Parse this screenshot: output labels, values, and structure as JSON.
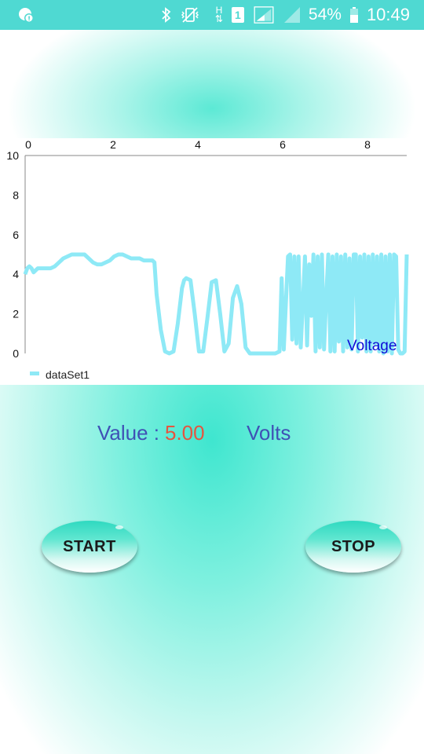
{
  "status_bar": {
    "battery_percent": "54%",
    "time": "10:49",
    "network_label_h": "H",
    "sim_slot": "1",
    "icons": [
      "notification-icon",
      "bluetooth-icon",
      "vibrate-icon",
      "network-h-icon",
      "sim-1-icon",
      "signal-icon",
      "signal-empty-icon",
      "battery-icon"
    ]
  },
  "chart_data": {
    "type": "line",
    "x_ticks": [
      "0",
      "2",
      "4",
      "6",
      "8"
    ],
    "y_ticks": [
      "10",
      "8",
      "6",
      "4",
      "2",
      "0"
    ],
    "xlim": [
      0,
      9
    ],
    "ylim": [
      0,
      10
    ],
    "annotation": "Voltage",
    "legend": {
      "position": "bottom-left"
    },
    "grid": false,
    "series": [
      {
        "name": "dataSet1",
        "color": "#8ee9f6",
        "x": [
          0,
          0.05,
          0.1,
          0.15,
          0.2,
          0.3,
          0.4,
          0.45,
          0.5,
          0.6,
          0.7,
          0.8,
          0.9,
          1.0,
          1.1,
          1.2,
          1.3,
          1.4,
          1.5,
          1.6,
          1.7,
          1.8,
          1.9,
          2.0,
          2.1,
          2.2,
          2.3,
          2.4,
          2.5,
          2.6,
          2.7,
          2.8,
          2.9,
          3.0,
          3.05,
          3.1,
          3.2,
          3.3,
          3.4,
          3.5,
          3.6,
          3.7,
          3.75,
          3.8,
          3.9,
          4.0,
          4.1,
          4.2,
          4.3,
          4.4,
          4.5,
          4.6,
          4.7,
          4.8,
          4.9,
          5.0,
          5.1,
          5.2,
          5.3,
          5.4,
          5.5,
          5.6,
          5.7,
          5.8,
          5.9,
          6.0,
          6.05,
          6.1,
          6.2,
          6.25,
          6.3,
          6.35,
          6.4,
          6.45,
          6.5,
          6.55,
          6.6,
          6.65,
          6.7,
          6.75,
          6.8,
          6.85,
          6.9,
          6.95,
          7.0,
          7.05,
          7.1,
          7.15,
          7.2,
          7.25,
          7.3,
          7.35,
          7.4,
          7.45,
          7.5,
          7.55,
          7.6,
          7.65,
          7.7,
          7.75,
          7.8,
          7.85,
          7.9,
          7.95,
          8.0,
          8.05,
          8.1,
          8.15,
          8.2,
          8.25,
          8.3,
          8.35,
          8.4,
          8.45,
          8.5,
          8.55,
          8.6,
          8.65,
          8.7,
          8.75,
          8.8,
          8.85,
          8.9,
          8.95,
          9.0
        ],
        "values": [
          4.0,
          4.3,
          4.4,
          4.3,
          4.1,
          4.3,
          4.3,
          4.3,
          4.3,
          4.3,
          4.4,
          4.6,
          4.8,
          4.9,
          5.0,
          5.0,
          5.0,
          5.0,
          4.8,
          4.6,
          4.5,
          4.5,
          4.6,
          4.7,
          4.9,
          5.0,
          5.0,
          4.9,
          4.8,
          4.8,
          4.8,
          4.7,
          4.7,
          4.7,
          4.6,
          3.0,
          1.2,
          0.1,
          0.0,
          0.1,
          1.5,
          3.3,
          3.7,
          3.8,
          3.7,
          2.0,
          0.1,
          0.1,
          1.8,
          3.6,
          3.7,
          2.0,
          0.1,
          0.5,
          2.8,
          3.4,
          2.5,
          0.3,
          0.0,
          0.0,
          0.0,
          0.0,
          0.0,
          0.0,
          0.0,
          0.1,
          3.8,
          0.2,
          4.9,
          5.0,
          0.7,
          4.9,
          0.5,
          4.9,
          0.3,
          2.5,
          4.9,
          0.4,
          4.5,
          1.9,
          5.0,
          0.1,
          4.9,
          0.3,
          5.0,
          0.2,
          2.8,
          5.0,
          0.1,
          4.9,
          0.1,
          5.0,
          0.6,
          4.9,
          0.1,
          5.0,
          0.3,
          4.8,
          0.2,
          5.0,
          5.0,
          0.1,
          4.9,
          0.8,
          5.0,
          0.1,
          4.9,
          0.1,
          5.0,
          0.5,
          4.9,
          0.1,
          5.0,
          0.0,
          4.9,
          0.1,
          5.0,
          0.0,
          5.0,
          4.9,
          0.2,
          0.0,
          0.0,
          0.1,
          5.0
        ]
      }
    ]
  },
  "readout": {
    "label": "Value :",
    "value": "5.00",
    "unit": "Volts"
  },
  "controls": {
    "start_label": "START",
    "stop_label": "STOP"
  }
}
